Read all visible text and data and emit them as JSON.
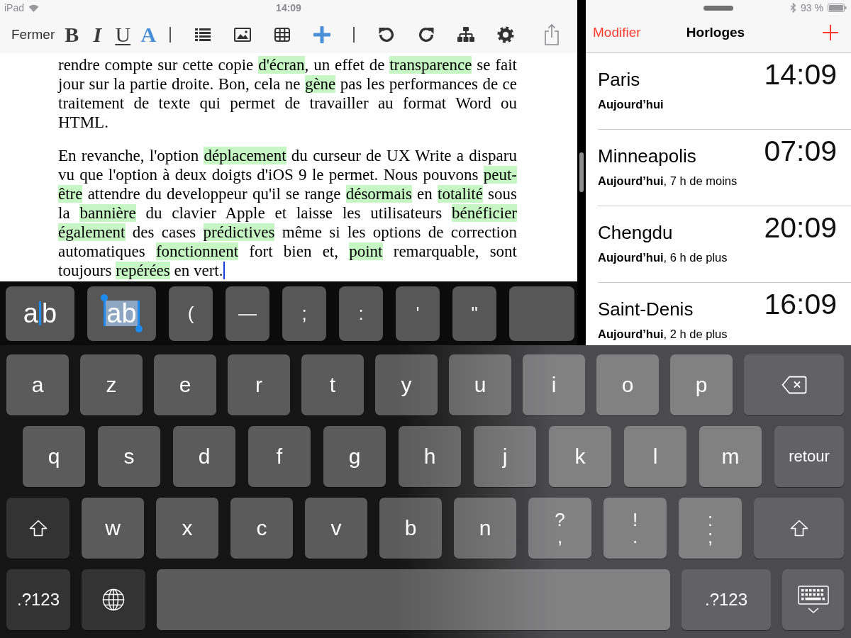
{
  "status_bar": {
    "device": "iPad",
    "time": "14:09",
    "battery": "93 %"
  },
  "editor": {
    "close_button": "Fermer",
    "format_buttons": [
      {
        "kind": "bold",
        "label": "B"
      },
      {
        "kind": "italic",
        "label": "I"
      },
      {
        "kind": "underline",
        "label": "U"
      },
      {
        "kind": "color",
        "label": "A"
      }
    ],
    "paragraphs": [
      [
        {
          "text": "rendre compte sur cette copie ",
          "highlighted": false
        },
        {
          "text": "d'écran",
          "highlighted": true
        },
        {
          "text": ", un effet de ",
          "highlighted": false
        },
        {
          "text": "transparence",
          "highlighted": true
        },
        {
          "text": " se fait jour sur la partie droite. Bon, cela ne ",
          "highlighted": false
        },
        {
          "text": "gène",
          "highlighted": true
        },
        {
          "text": " pas les performances de ce traitement de texte qui permet de travailler au format Word ou HTML.",
          "highlighted": false
        }
      ],
      [
        {
          "text": "En revanche, l'option ",
          "highlighted": false
        },
        {
          "text": "déplacement",
          "highlighted": true
        },
        {
          "text": " du curseur de UX Write a disparu vu que l'option à deux doigts d'iOS 9 le permet. Nous pouvons ",
          "highlighted": false
        },
        {
          "text": "peut-être",
          "highlighted": true
        },
        {
          "text": " attendre du developpeur qu'il se range ",
          "highlighted": false
        },
        {
          "text": "désormais",
          "highlighted": true
        },
        {
          "text": " en ",
          "highlighted": false
        },
        {
          "text": "totalité",
          "highlighted": true
        },
        {
          "text": " sous la ",
          "highlighted": false
        },
        {
          "text": "bannière",
          "highlighted": true
        },
        {
          "text": " du clavier Apple et laisse les utilisateurs ",
          "highlighted": false
        },
        {
          "text": "bénéficier ",
          "highlighted": true
        },
        {
          "text": "également",
          "highlighted": true
        },
        {
          "text": " des cases ",
          "highlighted": false
        },
        {
          "text": "prédictives",
          "highlighted": true
        },
        {
          "text": " même si les options de correction automatiques ",
          "highlighted": false
        },
        {
          "text": "fonctionnent",
          "highlighted": true
        },
        {
          "text": " fort bien et, ",
          "highlighted": false
        },
        {
          "text": "point",
          "highlighted": true
        },
        {
          "text": " remarquable, sont toujours ",
          "highlighted": false
        },
        {
          "text": "repérées",
          "highlighted": true
        },
        {
          "text": " en vert.",
          "highlighted": false
        }
      ]
    ]
  },
  "shortcut_bar": {
    "keys": [
      {
        "kind": "cursor",
        "before": "a",
        "after": "b"
      },
      {
        "kind": "selection",
        "label": "ab"
      },
      {
        "kind": "symbol",
        "label": "("
      },
      {
        "kind": "symbol",
        "label": "—"
      },
      {
        "kind": "symbol",
        "label": ";"
      },
      {
        "kind": "symbol",
        "label": ":"
      },
      {
        "kind": "symbol",
        "label": "'"
      },
      {
        "kind": "symbol",
        "label": "\""
      },
      {
        "kind": "blank"
      }
    ]
  },
  "clock": {
    "edit_button": "Modifier",
    "title": "Horloges",
    "cities": [
      {
        "name": "Paris",
        "day": "Aujourd’hui",
        "time": "14:09"
      },
      {
        "name": "Minneapolis",
        "day": "Aujourd’hui",
        "offset": ", 7 h de moins",
        "time": "07:09"
      },
      {
        "name": "Chengdu",
        "day": "Aujourd’hui",
        "offset": ", 6 h de plus",
        "time": "20:09"
      },
      {
        "name": "Saint-Denis",
        "day": "Aujourd’hui",
        "offset": ", 2 h de plus",
        "time": "16:09"
      }
    ]
  },
  "keyboard": {
    "key_rows": [
      {
        "keys": [
          {
            "kind": "letter",
            "label": "a"
          },
          {
            "kind": "letter",
            "label": "z"
          },
          {
            "kind": "letter",
            "label": "e"
          },
          {
            "kind": "letter",
            "label": "r"
          },
          {
            "kind": "letter",
            "label": "t"
          },
          {
            "kind": "letter",
            "label": "y"
          },
          {
            "kind": "letter",
            "label": "u"
          },
          {
            "kind": "letter",
            "label": "i"
          },
          {
            "kind": "letter",
            "label": "o"
          },
          {
            "kind": "letter",
            "label": "p"
          },
          {
            "kind": "backspace"
          }
        ]
      },
      {
        "keys": [
          {
            "kind": "letter",
            "label": "q"
          },
          {
            "kind": "letter",
            "label": "s"
          },
          {
            "kind": "letter",
            "label": "d"
          },
          {
            "kind": "letter",
            "label": "f"
          },
          {
            "kind": "letter",
            "label": "g"
          },
          {
            "kind": "letter",
            "label": "h"
          },
          {
            "kind": "letter",
            "label": "j"
          },
          {
            "kind": "letter",
            "label": "k"
          },
          {
            "kind": "letter",
            "label": "l"
          },
          {
            "kind": "letter",
            "label": "m"
          },
          {
            "kind": "return",
            "label": "retour"
          }
        ]
      },
      {
        "keys": [
          {
            "kind": "shift"
          },
          {
            "kind": "letter",
            "label": "w"
          },
          {
            "kind": "letter",
            "label": "x"
          },
          {
            "kind": "letter",
            "label": "c"
          },
          {
            "kind": "letter",
            "label": "v"
          },
          {
            "kind": "letter",
            "label": "b"
          },
          {
            "kind": "letter",
            "label": "n"
          },
          {
            "kind": "dual",
            "top": "?",
            "bottom": ","
          },
          {
            "kind": "dual",
            "top": "!",
            "bottom": "."
          },
          {
            "kind": "dual",
            "top": ":",
            "bottom": ";"
          },
          {
            "kind": "shift"
          }
        ]
      },
      {
        "keys": [
          {
            "kind": "numbers",
            "label": ".?123"
          },
          {
            "kind": "globe"
          },
          {
            "kind": "space"
          },
          {
            "kind": "numbers",
            "label": ".?123"
          },
          {
            "kind": "dismiss"
          }
        ]
      }
    ]
  }
}
